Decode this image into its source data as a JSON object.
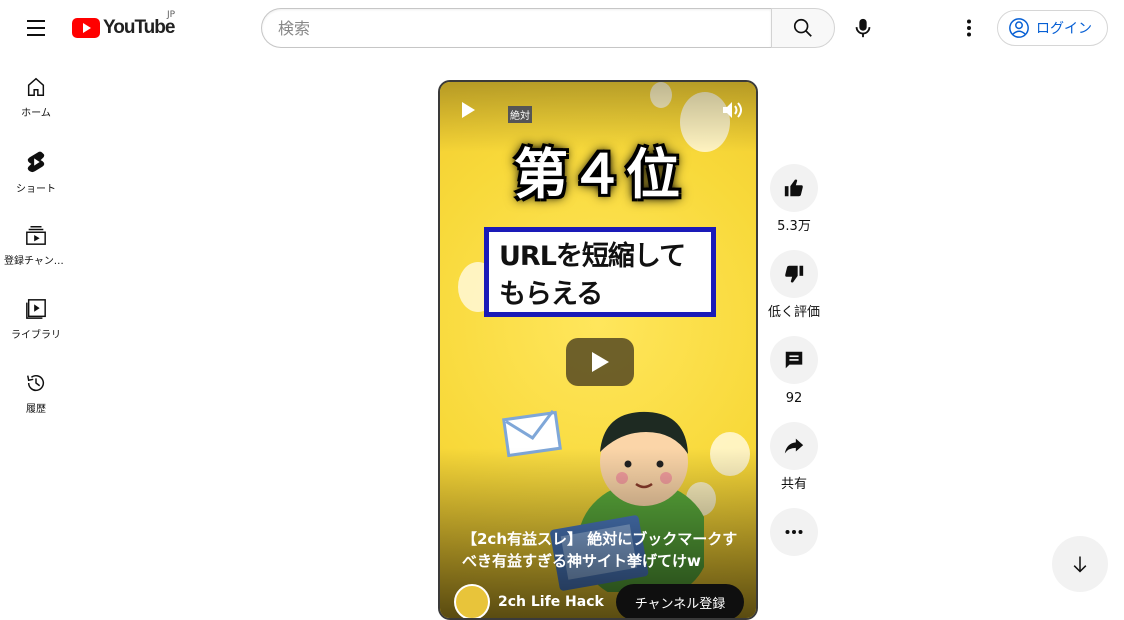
{
  "header": {
    "logo_text": "YouTube",
    "region": "JP",
    "search_placeholder": "検索",
    "login_label": "ログイン"
  },
  "sidebar": {
    "items": [
      {
        "label": "ホーム",
        "icon": "home-icon"
      },
      {
        "label": "ショート",
        "icon": "shorts-icon"
      },
      {
        "label": "登録チャンネル",
        "icon": "subscriptions-icon"
      },
      {
        "label": "ライブラリ",
        "icon": "library-icon"
      },
      {
        "label": "履歴",
        "icon": "history-icon"
      }
    ]
  },
  "short": {
    "tag": "絶対",
    "rank_text": "第４位",
    "headline_line1": "URLを短縮して",
    "headline_line2": "もらえる",
    "caption": "【2ch有益スレ】 絶対にブックマークすべき有益すぎる神サイト挙げてけw",
    "channel_name": "2ch Life Hack",
    "subscribe_label": "チャンネル登録"
  },
  "actions": {
    "like_count": "5.3万",
    "dislike_label": "低く評価",
    "comment_count": "92",
    "share_label": "共有"
  },
  "colors": {
    "brand_red": "#ff0000",
    "link_blue": "#065fd4",
    "thumb_yellow": "#f8d93a",
    "headline_border": "#1a1ab8"
  }
}
